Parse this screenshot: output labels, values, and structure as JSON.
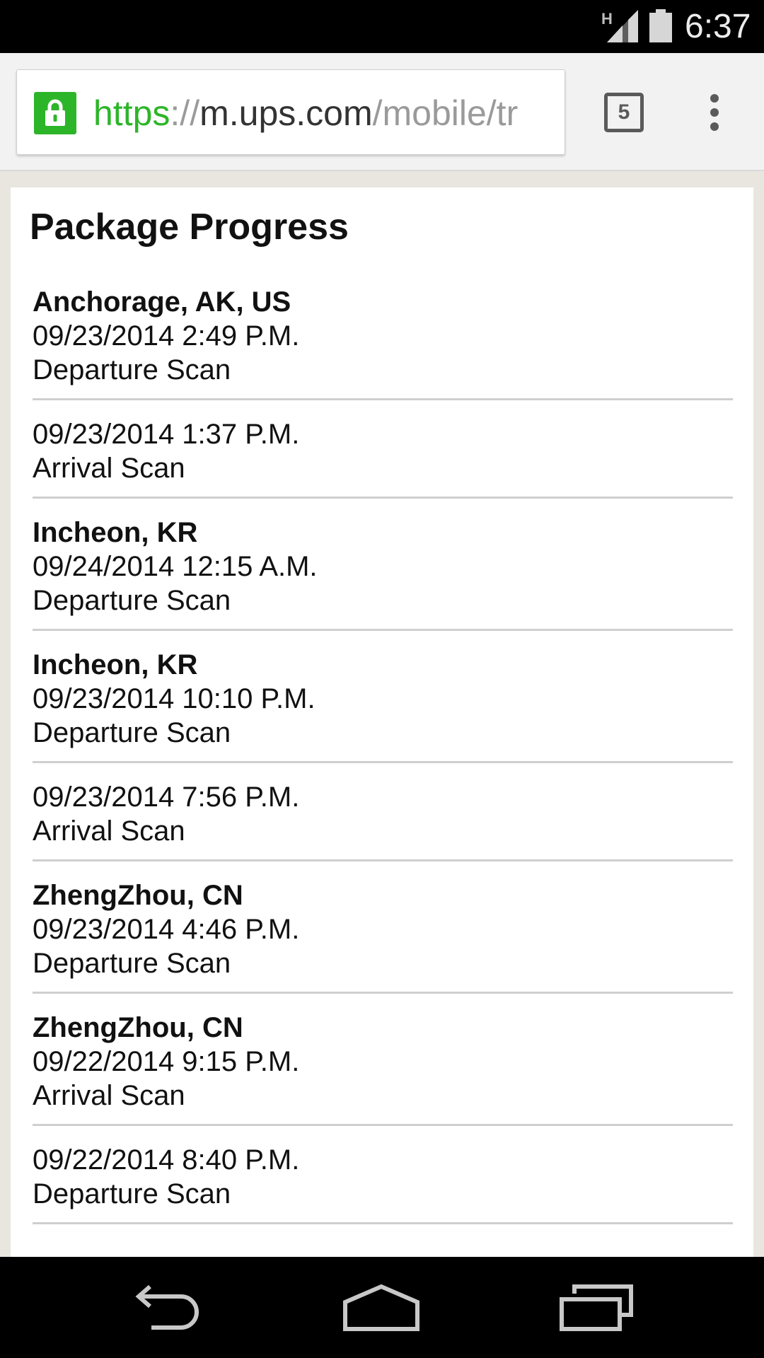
{
  "status_bar": {
    "network_type": "H",
    "time": "6:37",
    "icons": [
      "signal-icon",
      "battery-icon"
    ]
  },
  "browser": {
    "url": {
      "scheme": "https",
      "separator": "://",
      "host": "m.ups.com",
      "path": "/mobile/tr"
    },
    "tab_count": "5",
    "accent_color": "#2db52a",
    "icons": [
      "lock-icon",
      "tab-switcher-icon",
      "overflow-menu-icon"
    ]
  },
  "page": {
    "title": "Package Progress",
    "events": [
      {
        "location": "Anchorage, AK, US",
        "datetime": "09/23/2014 2:49 P.M.",
        "activity": "Departure Scan"
      },
      {
        "location": "",
        "datetime": "09/23/2014 1:37 P.M.",
        "activity": "Arrival Scan"
      },
      {
        "location": "Incheon, KR",
        "datetime": "09/24/2014 12:15 A.M.",
        "activity": "Departure Scan"
      },
      {
        "location": "Incheon, KR",
        "datetime": "09/23/2014 10:10 P.M.",
        "activity": "Departure Scan"
      },
      {
        "location": "",
        "datetime": "09/23/2014 7:56 P.M.",
        "activity": "Arrival Scan"
      },
      {
        "location": "ZhengZhou, CN",
        "datetime": "09/23/2014 4:46 P.M.",
        "activity": "Departure Scan"
      },
      {
        "location": "ZhengZhou, CN",
        "datetime": "09/22/2014 9:15 P.M.",
        "activity": "Arrival Scan"
      },
      {
        "location": "",
        "datetime": "09/22/2014 8:40 P.M.",
        "activity": "Departure Scan"
      }
    ]
  },
  "nav_bar": {
    "icons": [
      "back-icon",
      "home-icon",
      "recent-apps-icon"
    ]
  }
}
